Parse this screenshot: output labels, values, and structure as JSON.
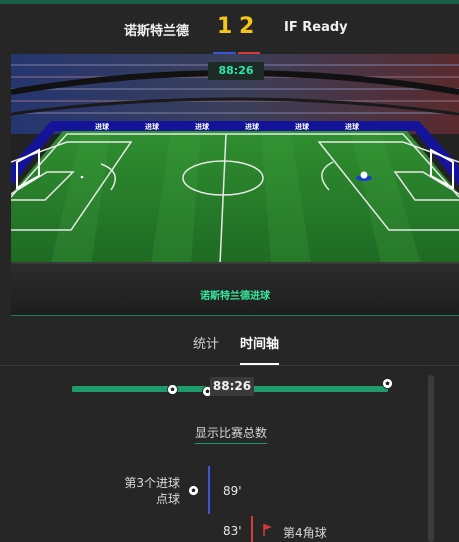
{
  "header": {
    "home_team": "诺斯特兰德",
    "away_team": "IF Ready",
    "home_score": "1",
    "away_score": "2",
    "home_color": "#3a58d6",
    "away_color": "#d63a3a"
  },
  "match": {
    "clock": "88:26",
    "event_text": "诺斯特兰德进球",
    "banner_text": "进球"
  },
  "tabs": [
    {
      "label": "统计"
    },
    {
      "label": "时间轴"
    }
  ],
  "timeline": {
    "current_time": "88:26",
    "show_total": "显示比赛总数",
    "events": [
      {
        "label": "第3个进球点球",
        "label_line1": "第3个进球",
        "label_line2": "点球",
        "minute": "89'",
        "icon": "football-icon",
        "side": "home"
      },
      {
        "label": "第4角球",
        "minute": "83'",
        "icon": "corner-flag-icon",
        "side": "away"
      }
    ]
  }
}
